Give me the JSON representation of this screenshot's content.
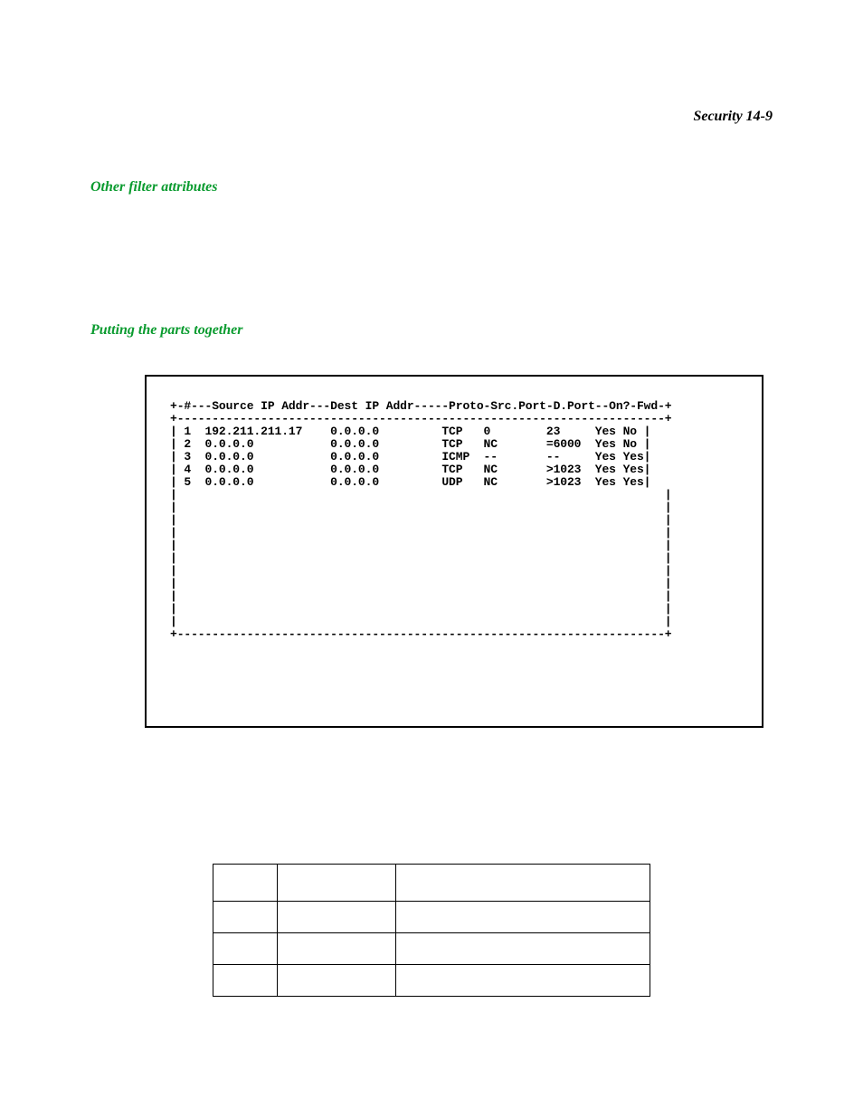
{
  "header": {
    "running_head": "Security  14-9"
  },
  "headings": {
    "other_filter_attributes": "Other filter attributes",
    "putting_together": "Putting the parts together"
  },
  "filter_table": {
    "header_line": "+-#---Source IP Addr---Dest IP Addr-----Proto-Src.Port-D.Port--On?-Fwd-+",
    "divider_top": "+----------------------------------------------------------------------+",
    "rows": [
      {
        "idx": "1",
        "src": "192.211.211.17",
        "dst": "0.0.0.0",
        "proto": "TCP",
        "sport": "0",
        "dport": "23",
        "on": "Yes",
        "fwd": "No"
      },
      {
        "idx": "2",
        "src": "0.0.0.0",
        "dst": "0.0.0.0",
        "proto": "TCP",
        "sport": "NC",
        "dport": "=6000",
        "on": "Yes",
        "fwd": "No"
      },
      {
        "idx": "3",
        "src": "0.0.0.0",
        "dst": "0.0.0.0",
        "proto": "ICMP",
        "sport": "--",
        "dport": "--",
        "on": "Yes",
        "fwd": "Yes"
      },
      {
        "idx": "4",
        "src": "0.0.0.0",
        "dst": "0.0.0.0",
        "proto": "TCP",
        "sport": "NC",
        "dport": ">1023",
        "on": "Yes",
        "fwd": "Yes"
      },
      {
        "idx": "5",
        "src": "0.0.0.0",
        "dst": "0.0.0.0",
        "proto": "UDP",
        "sport": "NC",
        "dport": ">1023",
        "on": "Yes",
        "fwd": "Yes"
      }
    ],
    "divider_bottom": "+----------------------------------------------------------------------+"
  },
  "proto_table": {
    "columns": [
      "",
      "",
      ""
    ],
    "rows": 3
  }
}
